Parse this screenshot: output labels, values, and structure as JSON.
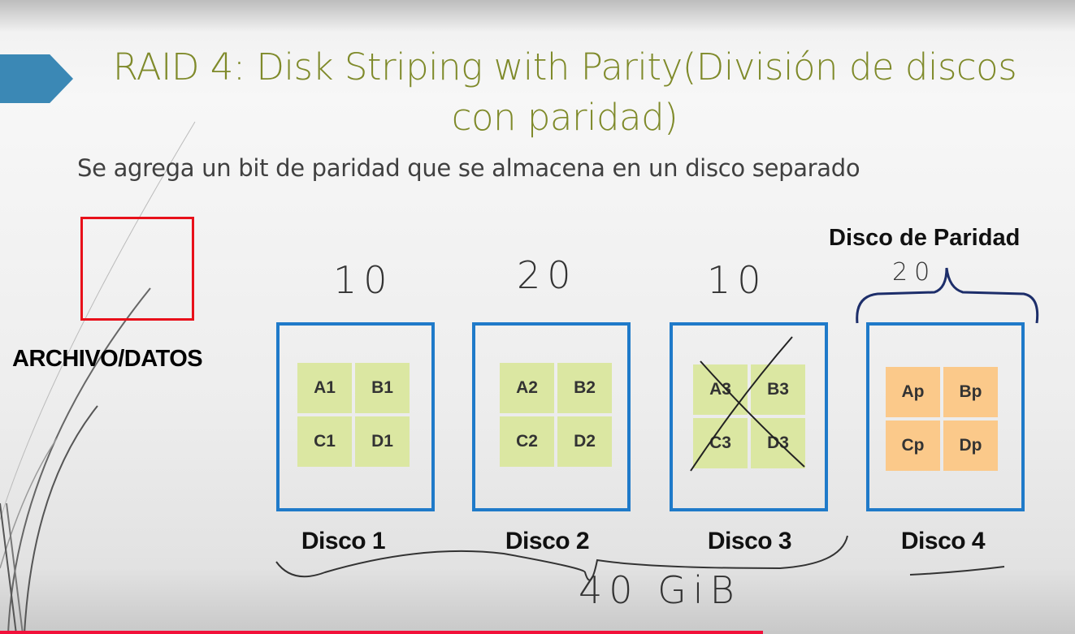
{
  "slide": {
    "title": "RAID 4: Disk Striping with Parity(División de discos con paridad)",
    "subtitle": "Se agrega un bit de paridad que se almacena en un disco separado",
    "file_label": "ARCHIVO/DATOS",
    "parity_label": "Disco de Paridad",
    "disks": [
      {
        "label": "Disco 1",
        "blocks": [
          "A1",
          "B1",
          "C1",
          "D1"
        ],
        "annotation": "10"
      },
      {
        "label": "Disco 2",
        "blocks": [
          "A2",
          "B2",
          "C2",
          "D2"
        ],
        "annotation": "20"
      },
      {
        "label": "Disco 3",
        "blocks": [
          "A3",
          "B3",
          "C3",
          "D3"
        ],
        "annotation": "10"
      },
      {
        "label": "Disco 4",
        "blocks": [
          "Ap",
          "Bp",
          "Cp",
          "Dp"
        ],
        "annotation": "20"
      }
    ],
    "total_annotation": "40 GiB"
  },
  "colors": {
    "title": "#7f8a2a",
    "disk_border": "#1f7ac9",
    "data_block": "#dbe7a2",
    "parity_block": "#fbc98a",
    "file_box": "#e8101a",
    "progress": "#f2103a"
  },
  "video": {
    "progress": 0.71
  }
}
